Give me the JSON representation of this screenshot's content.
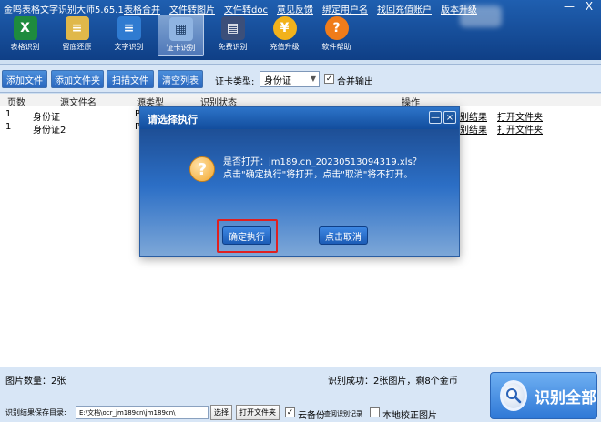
{
  "app": {
    "title": "金鸣表格文字识别大师5.65.1",
    "top_links": [
      "表格合并",
      "文件转图片",
      "文件转doc",
      "意见反馈",
      "绑定用户名",
      "找回充值账户",
      "版本升级"
    ],
    "window_controls": {
      "minimize": "—",
      "close": "X"
    }
  },
  "toolbar": {
    "items": [
      {
        "label": "表格识别",
        "icon": "excel-icon",
        "color": "#1e8b3e",
        "glyph": "X"
      },
      {
        "label": "留底还原",
        "icon": "document-icon",
        "color": "#e0b84a",
        "glyph": "≡"
      },
      {
        "label": "文字识别",
        "icon": "text-recognition-icon",
        "color": "#2f7bd1",
        "glyph": "≡"
      },
      {
        "label": "证卡识别",
        "icon": "idcard-icon",
        "color": "#8fb4e2",
        "glyph": "▦"
      },
      {
        "label": "免费识别",
        "icon": "book-icon",
        "color": "#3b4f7a",
        "glyph": "▤"
      },
      {
        "label": "充值升级",
        "icon": "coin-icon",
        "color": "#f2b21b",
        "glyph": "¥"
      },
      {
        "label": "软件帮助",
        "icon": "help-icon",
        "color": "#f07c1a",
        "glyph": "?"
      }
    ]
  },
  "actions": {
    "add_file": "添加文件",
    "add_folder": "添加文件夹",
    "scan_file": "扫描文件",
    "clear_list": "清空列表",
    "card_type_label": "证卡类型:",
    "card_type_value": "身份证",
    "merge_output_label": "合并输出",
    "merge_output_checked": "✓"
  },
  "table": {
    "headers": [
      "页数",
      "源文件名",
      "源类型",
      "识别状态",
      "操作"
    ],
    "rows": [
      {
        "page": "1",
        "name": "身份证",
        "type": "P",
        "result_link": "别结果",
        "open_folder": "打开文件夹"
      },
      {
        "page": "1",
        "name": "身份证2",
        "type": "P",
        "result_link": "别结果",
        "open_folder": "打开文件夹"
      }
    ]
  },
  "dialog": {
    "title": "请选择执行",
    "min": "—",
    "close": "×",
    "line1": "是否打开：jm189.cn_20230513094319.xls？",
    "line2": "点击\"确定执行\"将打开，点击\"取消\"将不打开。",
    "confirm": "确定执行",
    "cancel": "点击取消"
  },
  "bottom": {
    "image_count": "图片数量：2张",
    "success": "识别成功：2张图片，剩8个金币",
    "save_dir_label": "识别结果保存目录:",
    "save_dir_value": "E:\\文档\\ocr_jm189cn\\jm189cn\\",
    "choose": "选择",
    "open_folder": "打开文件夹",
    "cloud_backup": "云备份",
    "cloud_backup_checked": "✓",
    "view_records": "查阅识别记录",
    "local_correct": "本地校正图片",
    "recognize_all": "识别全部"
  }
}
